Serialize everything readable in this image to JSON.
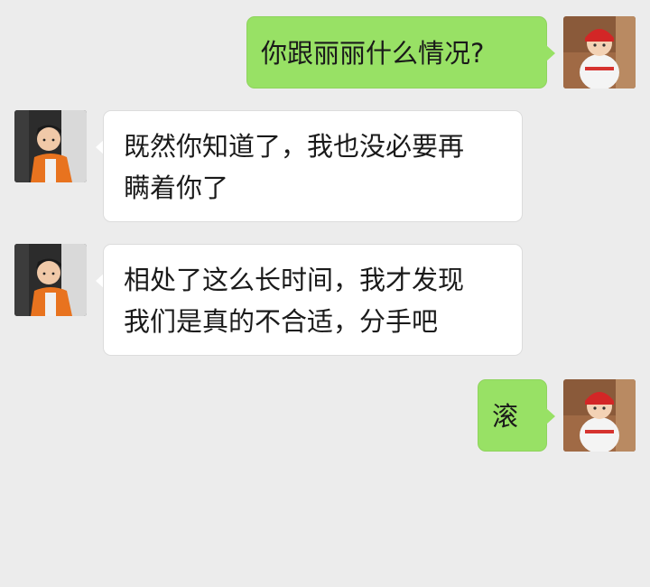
{
  "chat": {
    "messages": [
      {
        "from": "me",
        "lines": [
          "你跟丽丽什么情况?"
        ]
      },
      {
        "from": "other",
        "lines": [
          "既然你知道了，我也没必要再",
          "瞒着你了"
        ]
      },
      {
        "from": "other",
        "lines": [
          "相处了这么长时间，我才发现",
          "我们是真的不合适，分手吧"
        ]
      },
      {
        "from": "me",
        "lines": [
          "滚"
        ]
      }
    ]
  },
  "colors": {
    "background": "#ececec",
    "sent_bubble": "#98e165",
    "received_bubble": "#ffffff"
  },
  "icons": {
    "me_avatar": "girl-red-hat-avatar-icon",
    "other_avatar": "boy-orange-jacket-avatar-icon"
  }
}
